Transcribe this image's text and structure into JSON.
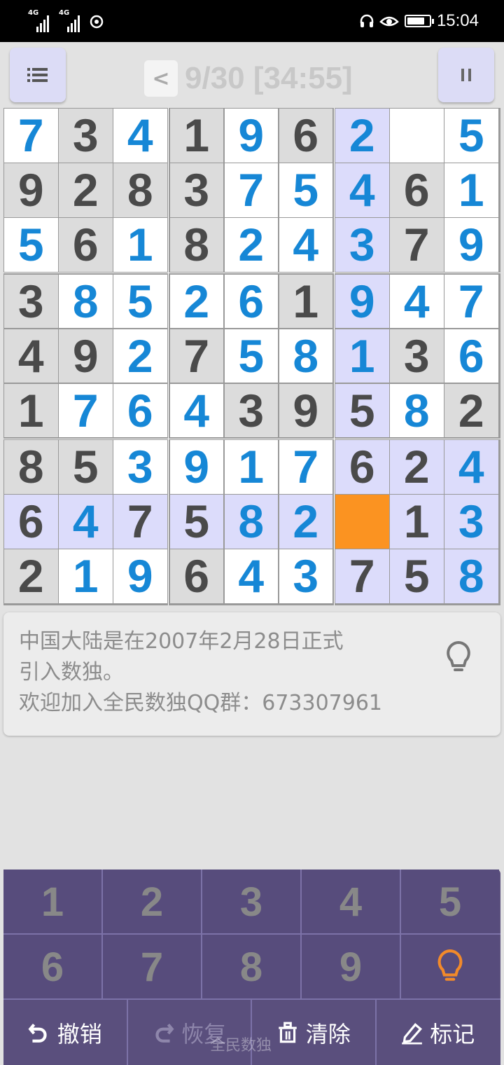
{
  "status_bar": {
    "signal_1": "4G",
    "signal_2": "4G",
    "time": "15:04"
  },
  "top_bar": {
    "back_label": "<",
    "progress": "9/30 [34:55]",
    "menu_icon": "menu-icon",
    "pause_icon": "pause-icon"
  },
  "board": {
    "highlight_row": 7,
    "highlight_col": 6,
    "selected": [
      7,
      6
    ],
    "cells": [
      [
        {
          "v": "7",
          "t": "e"
        },
        {
          "v": "3",
          "t": "g"
        },
        {
          "v": "4",
          "t": "e"
        },
        {
          "v": "1",
          "t": "g"
        },
        {
          "v": "9",
          "t": "e"
        },
        {
          "v": "6",
          "t": "g"
        },
        {
          "v": "2",
          "t": "e"
        },
        {
          "v": "",
          "t": "e"
        },
        {
          "v": "5",
          "t": "e"
        }
      ],
      [
        {
          "v": "9",
          "t": "g"
        },
        {
          "v": "2",
          "t": "g"
        },
        {
          "v": "8",
          "t": "g"
        },
        {
          "v": "3",
          "t": "g"
        },
        {
          "v": "7",
          "t": "e"
        },
        {
          "v": "5",
          "t": "e"
        },
        {
          "v": "4",
          "t": "e"
        },
        {
          "v": "6",
          "t": "g"
        },
        {
          "v": "1",
          "t": "e"
        }
      ],
      [
        {
          "v": "5",
          "t": "e"
        },
        {
          "v": "6",
          "t": "g"
        },
        {
          "v": "1",
          "t": "e"
        },
        {
          "v": "8",
          "t": "g"
        },
        {
          "v": "2",
          "t": "e"
        },
        {
          "v": "4",
          "t": "e"
        },
        {
          "v": "3",
          "t": "e"
        },
        {
          "v": "7",
          "t": "g"
        },
        {
          "v": "9",
          "t": "e"
        }
      ],
      [
        {
          "v": "3",
          "t": "g"
        },
        {
          "v": "8",
          "t": "e"
        },
        {
          "v": "5",
          "t": "e"
        },
        {
          "v": "2",
          "t": "e"
        },
        {
          "v": "6",
          "t": "e"
        },
        {
          "v": "1",
          "t": "g"
        },
        {
          "v": "9",
          "t": "e"
        },
        {
          "v": "4",
          "t": "e"
        },
        {
          "v": "7",
          "t": "e"
        }
      ],
      [
        {
          "v": "4",
          "t": "g"
        },
        {
          "v": "9",
          "t": "g"
        },
        {
          "v": "2",
          "t": "e"
        },
        {
          "v": "7",
          "t": "g"
        },
        {
          "v": "5",
          "t": "e"
        },
        {
          "v": "8",
          "t": "e"
        },
        {
          "v": "1",
          "t": "e"
        },
        {
          "v": "3",
          "t": "g"
        },
        {
          "v": "6",
          "t": "e"
        }
      ],
      [
        {
          "v": "1",
          "t": "g"
        },
        {
          "v": "7",
          "t": "e"
        },
        {
          "v": "6",
          "t": "e"
        },
        {
          "v": "4",
          "t": "e"
        },
        {
          "v": "3",
          "t": "g"
        },
        {
          "v": "9",
          "t": "g"
        },
        {
          "v": "5",
          "t": "g"
        },
        {
          "v": "8",
          "t": "e"
        },
        {
          "v": "2",
          "t": "g"
        }
      ],
      [
        {
          "v": "8",
          "t": "g"
        },
        {
          "v": "5",
          "t": "g"
        },
        {
          "v": "3",
          "t": "e"
        },
        {
          "v": "9",
          "t": "e"
        },
        {
          "v": "1",
          "t": "e"
        },
        {
          "v": "7",
          "t": "e"
        },
        {
          "v": "6",
          "t": "g"
        },
        {
          "v": "2",
          "t": "g"
        },
        {
          "v": "4",
          "t": "e"
        }
      ],
      [
        {
          "v": "6",
          "t": "g"
        },
        {
          "v": "4",
          "t": "e"
        },
        {
          "v": "7",
          "t": "g"
        },
        {
          "v": "5",
          "t": "g"
        },
        {
          "v": "8",
          "t": "e"
        },
        {
          "v": "2",
          "t": "e"
        },
        {
          "v": "",
          "t": "e"
        },
        {
          "v": "1",
          "t": "g"
        },
        {
          "v": "3",
          "t": "e"
        }
      ],
      [
        {
          "v": "2",
          "t": "g"
        },
        {
          "v": "1",
          "t": "e"
        },
        {
          "v": "9",
          "t": "e"
        },
        {
          "v": "6",
          "t": "g"
        },
        {
          "v": "4",
          "t": "e"
        },
        {
          "v": "3",
          "t": "e"
        },
        {
          "v": "7",
          "t": "g"
        },
        {
          "v": "5",
          "t": "g"
        },
        {
          "v": "8",
          "t": "e"
        }
      ]
    ]
  },
  "fact": {
    "line1": "中国大陆是在2007年2月28日正式",
    "line2": "引入数独。",
    "line3": "欢迎加入全民数独QQ群：673307961",
    "hint_icon": "lightbulb-icon"
  },
  "keypad": {
    "numbers": [
      "1",
      "2",
      "3",
      "4",
      "5",
      "6",
      "7",
      "8",
      "9"
    ],
    "hint_icon": "lightbulb-icon",
    "undo_label": "撤销",
    "redo_label": "恢复",
    "clear_label": "清除",
    "mark_label": "标记",
    "watermark": "全民数独"
  },
  "colors": {
    "given_digit": "#4a4a4a",
    "entered_digit": "#1687d6",
    "selected_cell": "#fb9321",
    "highlight": "#dcdcfb",
    "keypad_bg": "#5a4f7d",
    "hint_orange": "#f28a2a"
  }
}
